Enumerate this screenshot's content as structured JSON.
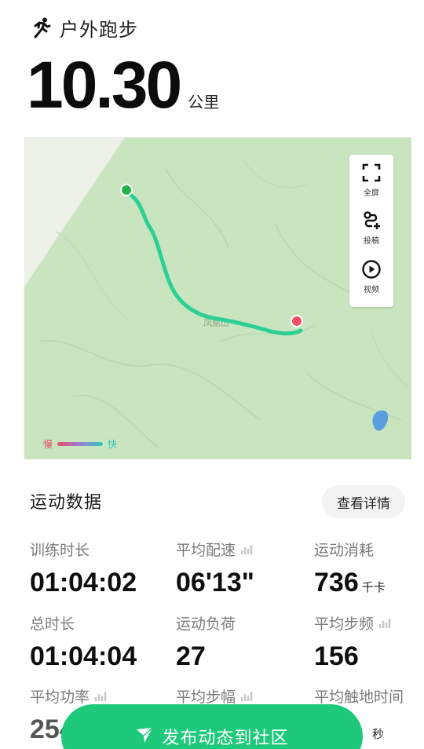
{
  "header": {
    "icon": "running-icon",
    "title": "户外跑步"
  },
  "distance": {
    "value": "10.30",
    "unit": "公里"
  },
  "map": {
    "colors": {
      "land": "#c9e5c0",
      "route": "#2ecf95",
      "start": "#23b045",
      "end": "#ef4d6a",
      "water": "#5a9ee0"
    },
    "place_label": "凤凰山",
    "tools": [
      {
        "icon": "fullscreen-icon",
        "label": "全屏"
      },
      {
        "icon": "route-post-icon",
        "label": "投稿"
      },
      {
        "icon": "play-video-icon",
        "label": "视频"
      }
    ],
    "legend": {
      "slow": "慢",
      "fast": "快"
    }
  },
  "stats_section": {
    "title": "运动数据",
    "detail_button": "查看详情",
    "items": [
      {
        "label": "训练时长",
        "value": "01:04:02",
        "unit": ""
      },
      {
        "label": "平均配速",
        "value": "06'13\"",
        "unit": "",
        "icon": "chart-icon"
      },
      {
        "label": "运动消耗",
        "value": "736",
        "unit": "千卡"
      },
      {
        "label": "总时长",
        "value": "01:04:04",
        "unit": ""
      },
      {
        "label": "运动负荷",
        "value": "27",
        "unit": ""
      },
      {
        "label": "平均步频",
        "value": "156",
        "unit": "",
        "icon": "chart-icon"
      },
      {
        "label": "平均功率",
        "value": "254",
        "unit": "",
        "icon": "chart-icon"
      },
      {
        "label": "平均步幅",
        "value": "",
        "unit": "",
        "icon": "chart-icon"
      },
      {
        "label": "平均触地时间",
        "value": "",
        "unit": "秒"
      }
    ]
  },
  "publish_button": {
    "icon": "send-arrow-icon",
    "label": "发布动态到社区"
  }
}
